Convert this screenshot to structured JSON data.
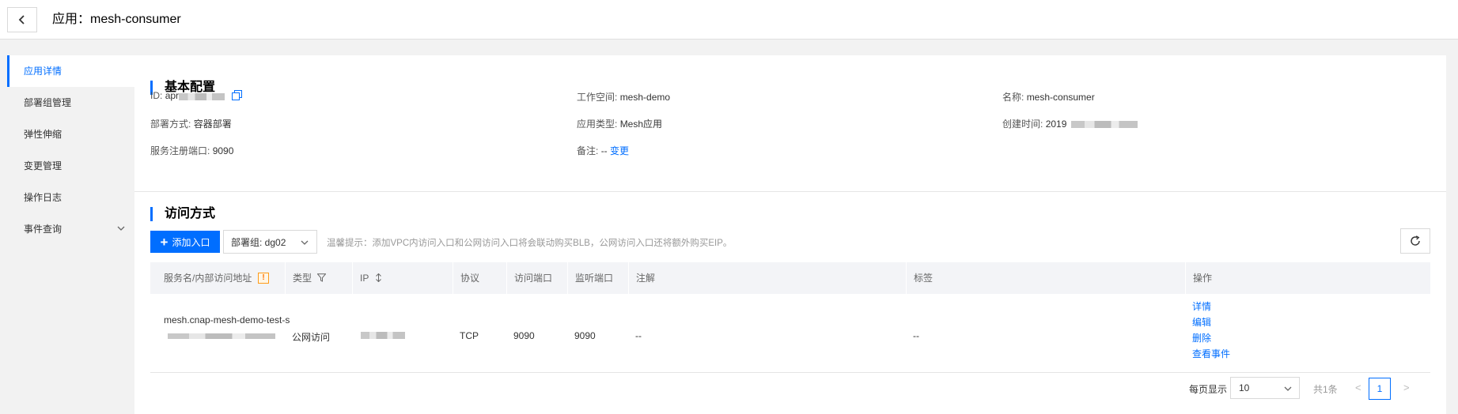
{
  "header": {
    "title": "应用：mesh-consumer"
  },
  "sidebar": {
    "items": [
      {
        "label": "应用详情"
      },
      {
        "label": "部署组管理"
      },
      {
        "label": "弹性伸缩"
      },
      {
        "label": "变更管理"
      },
      {
        "label": "操作日志"
      },
      {
        "label": "事件查询"
      }
    ]
  },
  "basic_config": {
    "title": "基本配置",
    "id_label": "ID:",
    "id_value": "apr",
    "workspace_label": "工作空间:",
    "workspace_value": "mesh-demo",
    "name_label": "名称:",
    "name_value": "mesh-consumer",
    "deploy_mode_label": "部署方式:",
    "deploy_mode_value": "容器部署",
    "app_type_label": "应用类型:",
    "app_type_value": "Mesh应用",
    "created_label": "创建时间:",
    "created_value": "2019",
    "port_label": "服务注册端口:",
    "port_value": "9090",
    "remark_label": "备注:",
    "remark_value": "--",
    "remark_change": "变更"
  },
  "access": {
    "title": "访问方式",
    "add_button": "添加入口",
    "group_select": "部署组: dg02",
    "tip": "温馨提示：添加VPC内访问入口和公网访问入口将会联动购买BLB，公网访问入口还将额外购买EIP。",
    "columns": {
      "service": "服务名/内部访问地址",
      "type": "类型",
      "ip": "IP",
      "protocol": "协议",
      "access_port": "访问端口",
      "listen_port": "监听端口",
      "annotation": "注解",
      "tags": "标签",
      "ops": "操作"
    },
    "rows": [
      {
        "service": "mesh.cnap-mesh-demo-test-s",
        "type": "公网访问",
        "protocol": "TCP",
        "access_port": "9090",
        "listen_port": "9090",
        "annotation": "--",
        "tags": "--",
        "ops": [
          "详情",
          "编辑",
          "删除",
          "查看事件"
        ]
      }
    ]
  },
  "pagination": {
    "per_page_label": "每页显示",
    "per_page_value": "10",
    "total": "共1条",
    "prev": "<",
    "page": "1",
    "next": ">"
  },
  "colors": {
    "accent": "#006eff",
    "warning": "#ff7200"
  },
  "icons": [
    "chevron-left-icon",
    "copy-icon",
    "chevron-down-icon",
    "plus-icon",
    "refresh-icon",
    "warning-icon",
    "filter-icon",
    "sort-icon"
  ]
}
